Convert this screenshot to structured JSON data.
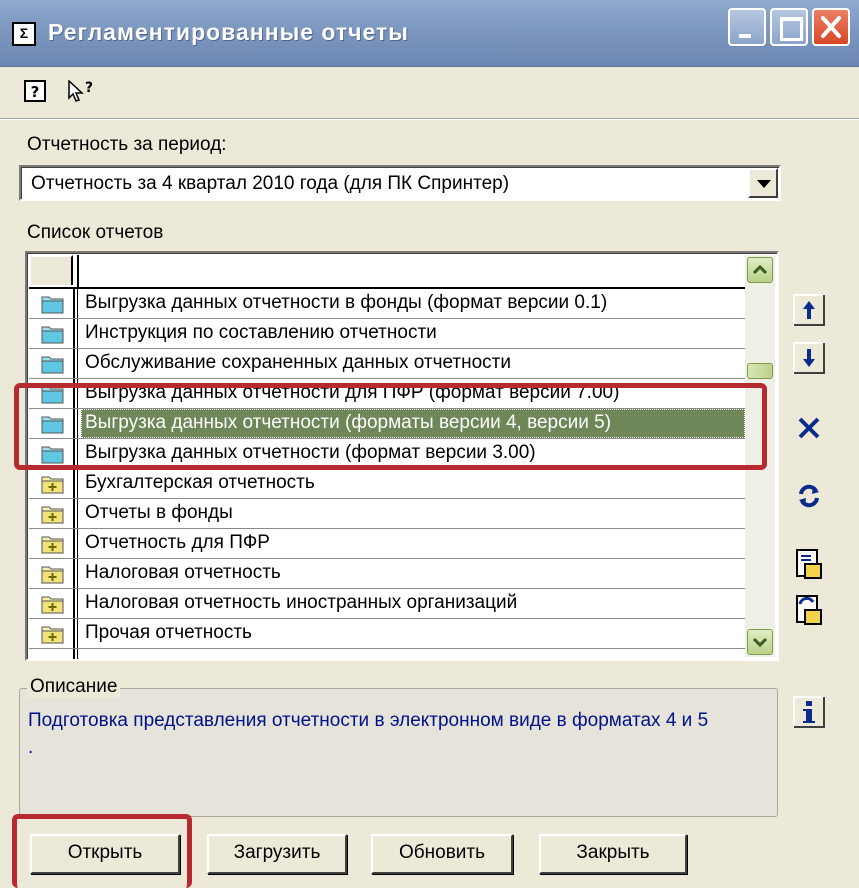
{
  "window": {
    "title": "Регламентированные отчеты",
    "icon_glyph": "Σ"
  },
  "toolbar": {
    "help_icon": "help-icon",
    "whats_this_icon": "whats-this-icon"
  },
  "period": {
    "label": "Отчетность за период:",
    "selected": "Отчетность за 4 квартал 2010 года (для ПК Спринтер)"
  },
  "reports": {
    "label": "Список отчетов",
    "items": [
      {
        "label": "Выгрузка данных отчетности в фонды (формат версии 0.1)",
        "icon": "blue-folder-icon"
      },
      {
        "label": "Инструкция по составлению отчетности",
        "icon": "blue-folder-icon"
      },
      {
        "label": "Обслуживание сохраненных данных отчетности",
        "icon": "blue-folder-icon"
      },
      {
        "label": "Выгрузка данных отчетности для ПФР (формат версии 7.00)",
        "icon": "blue-folder-icon"
      },
      {
        "label": "Выгрузка данных отчетности (форматы версии 4, версии 5)",
        "icon": "blue-folder-icon",
        "selected": true
      },
      {
        "label": "Выгрузка данных отчетности (формат версии 3.00)",
        "icon": "blue-folder-icon"
      },
      {
        "label": "Бухгалтерская отчетность",
        "icon": "yellow-folder-plus-icon"
      },
      {
        "label": "Отчеты в фонды",
        "icon": "yellow-folder-plus-icon"
      },
      {
        "label": "Отчетность для ПФР",
        "icon": "yellow-folder-plus-icon"
      },
      {
        "label": "Налоговая отчетность",
        "icon": "yellow-folder-plus-icon"
      },
      {
        "label": "Налоговая отчетность иностранных организаций",
        "icon": "yellow-folder-plus-icon"
      },
      {
        "label": "Прочая отчетность",
        "icon": "yellow-folder-plus-icon"
      }
    ]
  },
  "description": {
    "label": "Описание",
    "text": "Подготовка представления отчетности в электронном виде в форматах 4 и 5        ."
  },
  "buttons": {
    "open": "Открыть",
    "load": "Загрузить",
    "update": "Обновить",
    "close": "Закрыть"
  },
  "colors": {
    "selection": "#6e8658",
    "highlight_box": "#b62a30",
    "description_text": "#00118c"
  }
}
